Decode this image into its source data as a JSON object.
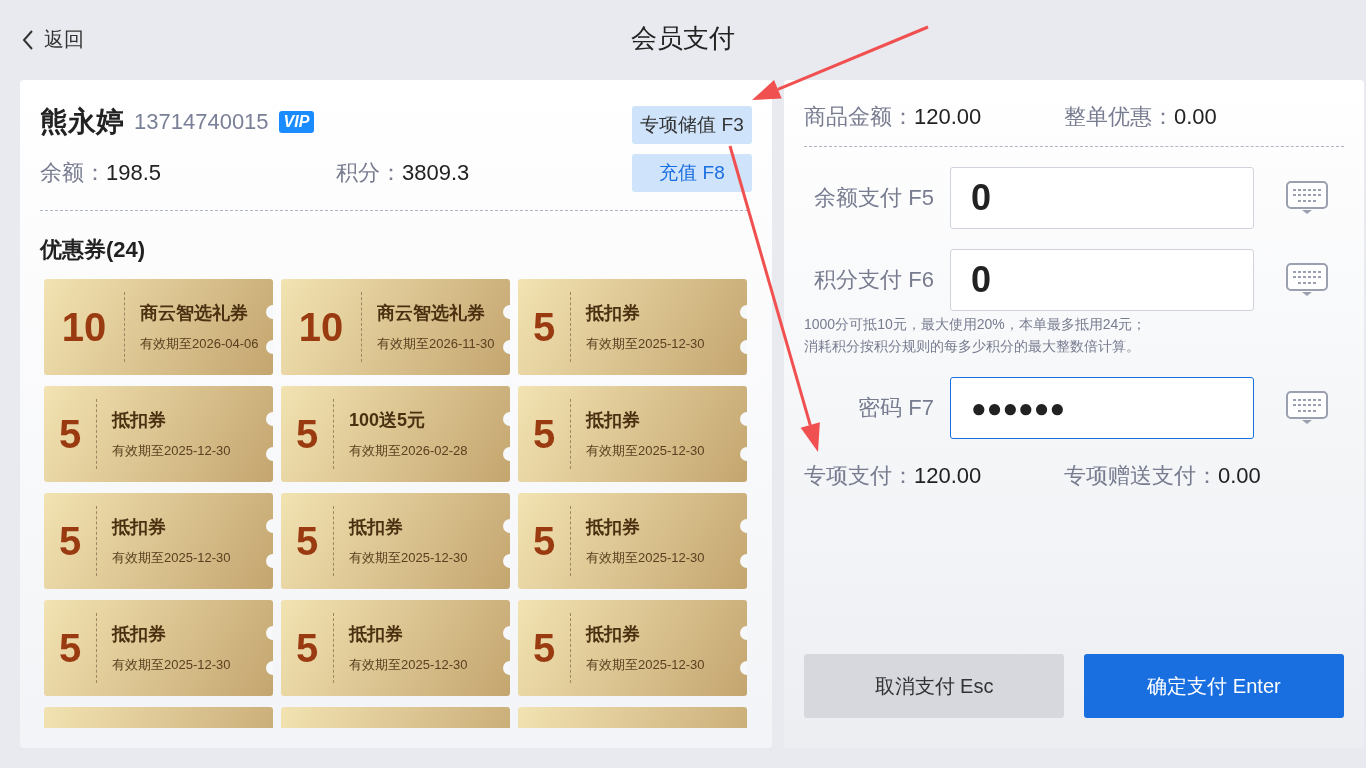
{
  "header": {
    "back": "返回",
    "title": "会员支付"
  },
  "member": {
    "name": "熊永婷",
    "phone": "13714740015",
    "badge": "VIP",
    "balance_label": "余额：",
    "balance": "198.5",
    "points_label": "积分：",
    "points": "3809.3"
  },
  "member_actions": [
    {
      "label": "专项储值 F3",
      "kind": "plain"
    },
    {
      "label": "充值 F8",
      "kind": "primary"
    }
  ],
  "coupons_title": "优惠券(24)",
  "coupons": [
    {
      "kind": "full",
      "value": "10",
      "name": "商云智选礼券",
      "expiry": "有效期至2026-04-06"
    },
    {
      "kind": "full",
      "value": "10",
      "name": "商云智选礼券",
      "expiry": "有效期至2026-11-30"
    },
    {
      "kind": "full",
      "value": "5",
      "name": "抵扣券",
      "expiry": "有效期至2025-12-30"
    },
    {
      "kind": "full",
      "value": "5",
      "name": "抵扣券",
      "expiry": "有效期至2025-12-30"
    },
    {
      "kind": "full",
      "value": "5",
      "name": "100送5元",
      "expiry": "有效期至2026-02-28"
    },
    {
      "kind": "full",
      "value": "5",
      "name": "抵扣券",
      "expiry": "有效期至2025-12-30"
    },
    {
      "kind": "full",
      "value": "5",
      "name": "抵扣券",
      "expiry": "有效期至2025-12-30"
    },
    {
      "kind": "full",
      "value": "5",
      "name": "抵扣券",
      "expiry": "有效期至2025-12-30"
    },
    {
      "kind": "full",
      "value": "5",
      "name": "抵扣券",
      "expiry": "有效期至2025-12-30"
    },
    {
      "kind": "full",
      "value": "5",
      "name": "抵扣券",
      "expiry": "有效期至2025-12-30"
    },
    {
      "kind": "full",
      "value": "5",
      "name": "抵扣券",
      "expiry": "有效期至2025-12-30"
    },
    {
      "kind": "full",
      "value": "5",
      "name": "抵扣券",
      "expiry": "有效期至2025-12-30"
    },
    {
      "kind": "cut"
    },
    {
      "kind": "cut"
    },
    {
      "kind": "cut"
    }
  ],
  "summary": [
    {
      "label": "商品金额：",
      "value": "120.00"
    },
    {
      "label": "整单优惠：",
      "value": "0.00"
    }
  ],
  "payment_fields": [
    {
      "label": "余额支付 F5",
      "value": "0",
      "kind": "amount",
      "focused": false
    },
    {
      "label": "积分支付 F6",
      "value": "0",
      "kind": "amount",
      "focused": false
    },
    {
      "label": "密码 F7",
      "value": "●●●●●●",
      "kind": "password",
      "focused": true
    }
  ],
  "points_note": [
    "1000分可抵10元，最大使用20%，本单最多抵用24元；",
    "消耗积分按积分规则的每多少积分的最大整数倍计算。"
  ],
  "special": [
    {
      "label": "专项支付：",
      "value": "120.00"
    },
    {
      "label": "专项赠送支付：",
      "value": "0.00"
    }
  ],
  "buttons": [
    {
      "label": "取消支付 Esc",
      "kind": "cancel"
    },
    {
      "label": "确定支付 Enter",
      "kind": "confirm"
    }
  ],
  "annotations": [
    {
      "kind": "arrow"
    },
    {
      "kind": "arrow"
    }
  ]
}
